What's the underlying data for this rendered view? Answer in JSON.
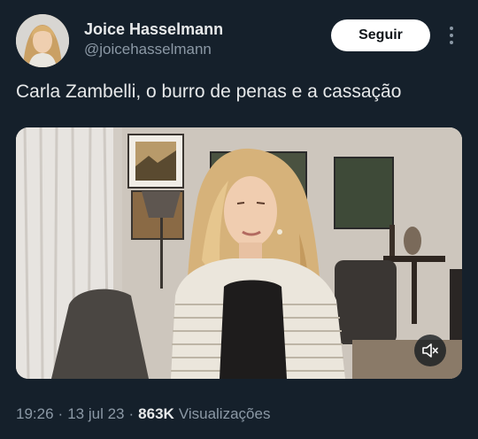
{
  "author": {
    "name": "Joice Hasselmann",
    "handle": "@joicehasselmann",
    "avatar_icon": "profile-photo"
  },
  "follow_button": {
    "label": "Seguir"
  },
  "more_menu": {
    "icon": "more-vertical-icon"
  },
  "tweet": {
    "text": "Carla Zambelli, o burro de penas e a cassação"
  },
  "media": {
    "type": "video",
    "mute_icon": "speaker-muted-icon"
  },
  "meta": {
    "time": "19:26",
    "separator": "·",
    "date": "13 jul 23",
    "views_count": "863K",
    "views_label": "Visualizações"
  },
  "colors": {
    "background": "#15202b",
    "primary_text": "#e7e9ea",
    "secondary_text": "#8b98a5",
    "button_bg": "#ffffff",
    "button_text": "#0f1419"
  }
}
